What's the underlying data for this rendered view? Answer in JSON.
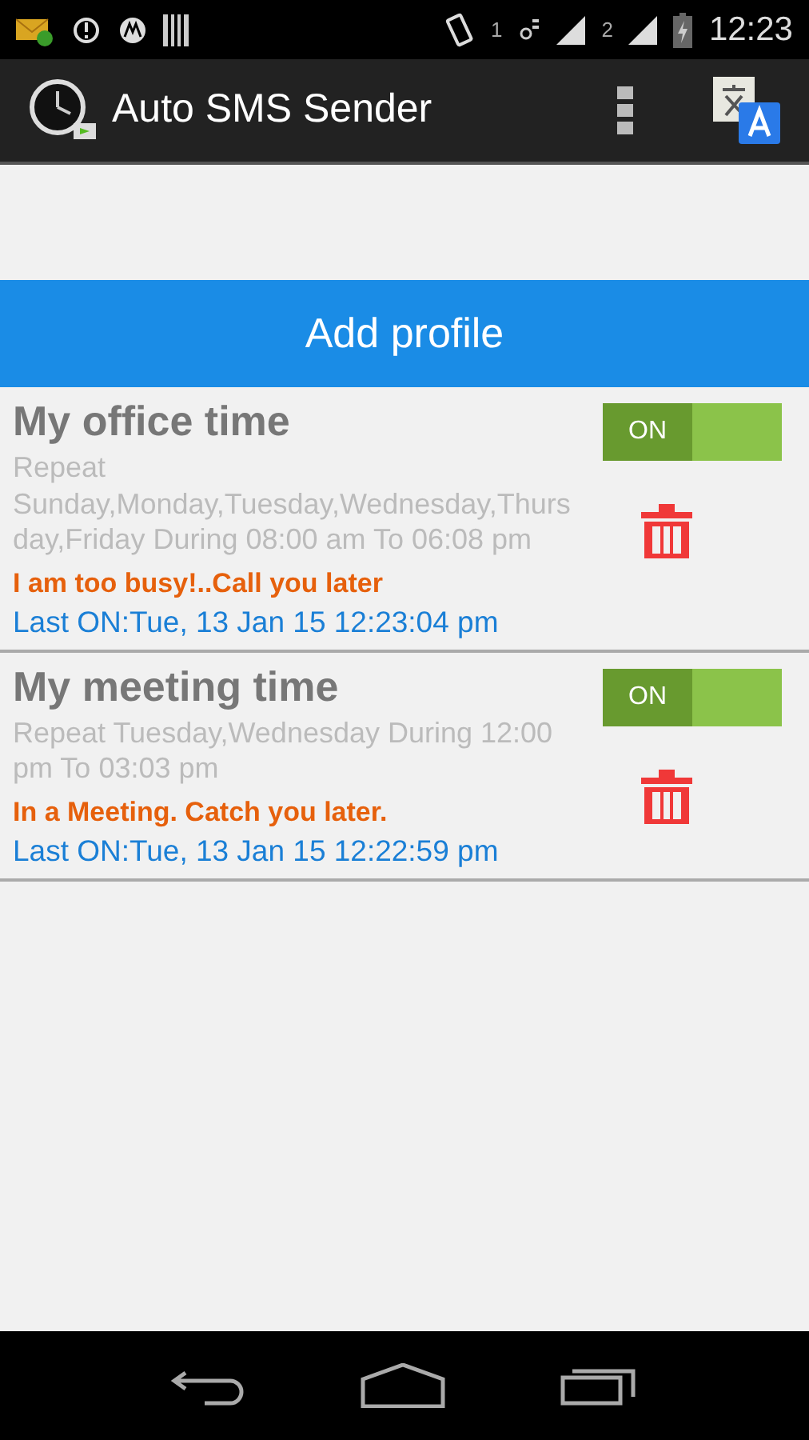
{
  "status_bar": {
    "sim_1": "1",
    "sim_2": "2",
    "time": "12:23"
  },
  "app_bar": {
    "title": "Auto SMS Sender"
  },
  "add_button": "Add profile",
  "profiles": [
    {
      "name": "My office time",
      "schedule": "Repeat Sunday,Monday,Tuesday,Wednesday,Thursday,Friday During 08:00 am To 06:08 pm",
      "message": "I am too busy!..Call you later",
      "last_on": "Last ON:Tue, 13 Jan 15 12:23:04 pm",
      "switch_label": "ON",
      "on": true
    },
    {
      "name": "My meeting time",
      "schedule": "Repeat Tuesday,Wednesday During 12:00 pm To 03:03 pm",
      "message": "In a Meeting. Catch you later.",
      "last_on": "Last ON:Tue, 13 Jan 15 12:22:59 pm",
      "switch_label": "ON",
      "on": true
    }
  ]
}
